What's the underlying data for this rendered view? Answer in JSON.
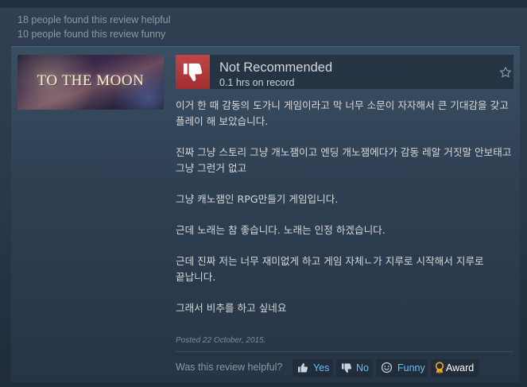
{
  "previous_review": {
    "helpful_line": "18 people found this review helpful",
    "funny_line": "10 people found this review funny"
  },
  "review": {
    "game_capsule_text": "TO THE MOON",
    "recommendation": "Not Recommended",
    "hours_on_record": "0.1 hrs on record",
    "paragraphs": [
      "이거 한 때 감동의 도가니 게임이라고 막 너무 소문이 자자해서 큰 기대감을 갖고 플레이 해 보았습니다.",
      "진짜 그냥 스토리 그냥 개노잼이고 엔딩 개노잼에다가 감동 레알 거짓말 안보태고 그냥 그런거 없고",
      "그냥 캐노잼인 RPG만들기 게임입니다.",
      "근데 노래는 참 좋습니다. 노래는 인정 하겠습니다.",
      "근데 진짜 저는 너무 재미없게 하고 게임 자체ㄴ가 지루로 시작해서 지루로 끝납니다.",
      "그래서 비추를 하고 싶네요"
    ],
    "posted_date": "Posted 22 October, 2015."
  },
  "feedback": {
    "question": "Was this review helpful?",
    "yes_label": "Yes",
    "no_label": "No",
    "funny_label": "Funny",
    "award_label": "Award"
  },
  "colors": {
    "background": "#1b2838",
    "thumbs_down_bg": "#b03a3a",
    "link_blue": "#66c0f4",
    "award_text": "#ffffff",
    "muted_text": "#8f98a0"
  },
  "icons": {
    "thumbs_down": "thumbs-down-icon",
    "favorite": "star-icon",
    "vote_yes": "thumbs-up-icon",
    "vote_no": "thumbs-down-icon",
    "vote_funny": "smiley-icon",
    "award": "award-icon"
  }
}
